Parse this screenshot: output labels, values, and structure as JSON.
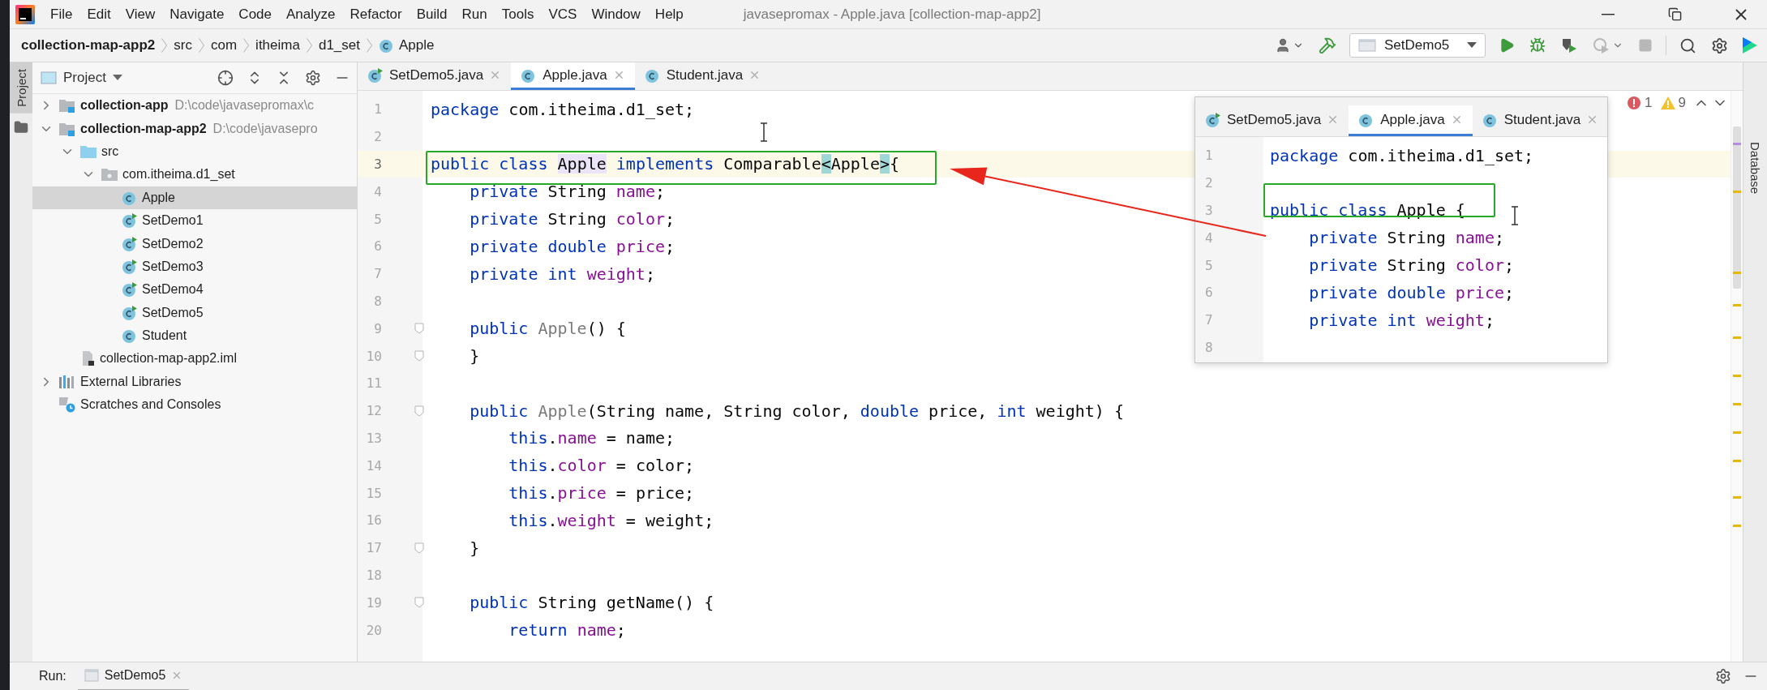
{
  "window": {
    "title": "javasepromax - Apple.java [collection-map-app2]"
  },
  "menu": [
    "File",
    "Edit",
    "View",
    "Navigate",
    "Code",
    "Analyze",
    "Refactor",
    "Build",
    "Run",
    "Tools",
    "VCS",
    "Window",
    "Help"
  ],
  "breadcrumbs": [
    {
      "label": "collection-map-app2",
      "kind": "project"
    },
    {
      "label": "src",
      "kind": "folder"
    },
    {
      "label": "com",
      "kind": "folder"
    },
    {
      "label": "itheima",
      "kind": "folder"
    },
    {
      "label": "d1_set",
      "kind": "folder"
    },
    {
      "label": "Apple",
      "kind": "class"
    }
  ],
  "toolbar": {
    "run_configuration": "SetDemo5",
    "actions": [
      {
        "kind": "run",
        "disabled": false
      },
      {
        "kind": "debug",
        "disabled": false
      },
      {
        "kind": "coverage",
        "disabled": false
      },
      {
        "kind": "profile",
        "disabled": true
      },
      {
        "kind": "stop",
        "disabled": true
      }
    ]
  },
  "tool_windows": {
    "left": [
      {
        "label": "Project",
        "selected": true
      }
    ],
    "right": [
      {
        "label": "Database",
        "selected": false
      }
    ]
  },
  "project_panel": {
    "title": "Project",
    "tree": [
      {
        "label": "collection-app",
        "path": "D:\\code\\javasepromax\\c",
        "kind": "module",
        "expanded": false,
        "selected": false
      },
      {
        "label": "collection-map-app2",
        "path": "D:\\code\\javasepro",
        "kind": "module",
        "expanded": true,
        "selected": false,
        "children": [
          {
            "label": "src",
            "kind": "source-folder",
            "expanded": true,
            "selected": false,
            "children": [
              {
                "label": "com.itheima.d1_set",
                "kind": "package",
                "expanded": true,
                "selected": false,
                "children": [
                  {
                    "label": "Apple",
                    "kind": "class",
                    "selected": true
                  },
                  {
                    "label": "SetDemo1",
                    "kind": "runnable",
                    "selected": false
                  },
                  {
                    "label": "SetDemo2",
                    "kind": "runnable",
                    "selected": false
                  },
                  {
                    "label": "SetDemo3",
                    "kind": "runnable",
                    "selected": false
                  },
                  {
                    "label": "SetDemo4",
                    "kind": "runnable",
                    "selected": false
                  },
                  {
                    "label": "SetDemo5",
                    "kind": "runnable",
                    "selected": false
                  },
                  {
                    "label": "Student",
                    "kind": "class",
                    "selected": false
                  }
                ]
              }
            ]
          },
          {
            "label": "collection-map-app2.iml",
            "kind": "file",
            "selected": false
          }
        ]
      },
      {
        "label": "External Libraries",
        "kind": "libraries",
        "expanded": false,
        "selected": false
      },
      {
        "label": "Scratches and Consoles",
        "kind": "scratches",
        "selected": false
      }
    ]
  },
  "editor": {
    "tabs": [
      {
        "label": "SetDemo5.java",
        "kind": "runnable",
        "selected": false
      },
      {
        "label": "Apple.java",
        "kind": "class",
        "selected": true
      },
      {
        "label": "Student.java",
        "kind": "class",
        "selected": false
      }
    ],
    "problems": {
      "errors": "1",
      "warnings": "9"
    },
    "lines": [
      {
        "number": "1",
        "current": false,
        "fold": false,
        "tokens": [
          {
            "kind": "keyword",
            "text": "package"
          },
          {
            "kind": "plain",
            "text": " com.itheima.d1_set;"
          }
        ]
      },
      {
        "number": "2",
        "current": false,
        "fold": false
      },
      {
        "number": "3",
        "current": true,
        "fold": false,
        "tokens": [
          {
            "kind": "keyword",
            "text": "public class "
          },
          {
            "kind": "usage",
            "text": "Apple"
          },
          {
            "kind": "keyword",
            "text": " implements"
          },
          {
            "kind": "plain",
            "text": " Comparable"
          },
          {
            "kind": "brace",
            "text": "<"
          },
          {
            "kind": "plain",
            "text": "Apple"
          },
          {
            "kind": "brace",
            "text": ">"
          },
          {
            "kind": "plain",
            "text": "{"
          }
        ]
      },
      {
        "number": "4",
        "current": false,
        "fold": false,
        "tokens": [
          {
            "kind": "keyword",
            "text": "    private"
          },
          {
            "kind": "plain",
            "text": " String "
          },
          {
            "kind": "field",
            "text": "name"
          },
          {
            "kind": "plain",
            "text": ";"
          }
        ]
      },
      {
        "number": "5",
        "current": false,
        "fold": false,
        "tokens": [
          {
            "kind": "keyword",
            "text": "    private"
          },
          {
            "kind": "plain",
            "text": " String "
          },
          {
            "kind": "field",
            "text": "color"
          },
          {
            "kind": "plain",
            "text": ";"
          }
        ]
      },
      {
        "number": "6",
        "current": false,
        "fold": false,
        "tokens": [
          {
            "kind": "keyword",
            "text": "    private double "
          },
          {
            "kind": "field",
            "text": "price"
          },
          {
            "kind": "plain",
            "text": ";"
          }
        ]
      },
      {
        "number": "7",
        "current": false,
        "fold": false,
        "tokens": [
          {
            "kind": "keyword",
            "text": "    private int "
          },
          {
            "kind": "field",
            "text": "weight"
          },
          {
            "kind": "plain",
            "text": ";"
          }
        ]
      },
      {
        "number": "8",
        "current": false,
        "fold": false
      },
      {
        "number": "9",
        "current": false,
        "fold": true,
        "tokens": [
          {
            "kind": "keyword",
            "text": "    public "
          },
          {
            "kind": "unused",
            "text": "Apple"
          },
          {
            "kind": "plain",
            "text": "() {"
          }
        ]
      },
      {
        "number": "10",
        "current": false,
        "fold": true,
        "tokens": [
          {
            "kind": "plain",
            "text": "    }"
          }
        ]
      },
      {
        "number": "11",
        "current": false,
        "fold": false
      },
      {
        "number": "12",
        "current": false,
        "fold": true,
        "tokens": [
          {
            "kind": "keyword",
            "text": "    public "
          },
          {
            "kind": "unused",
            "text": "Apple"
          },
          {
            "kind": "plain",
            "text": "(String name, String color, "
          },
          {
            "kind": "keyword",
            "text": "double"
          },
          {
            "kind": "plain",
            "text": " price, "
          },
          {
            "kind": "keyword",
            "text": "int"
          },
          {
            "kind": "plain",
            "text": " weight) {"
          }
        ]
      },
      {
        "number": "13",
        "current": false,
        "fold": false,
        "tokens": [
          {
            "kind": "keyword",
            "text": "        this"
          },
          {
            "kind": "plain",
            "text": "."
          },
          {
            "kind": "field",
            "text": "name"
          },
          {
            "kind": "plain",
            "text": " = name;"
          }
        ]
      },
      {
        "number": "14",
        "current": false,
        "fold": false,
        "tokens": [
          {
            "kind": "keyword",
            "text": "        this"
          },
          {
            "kind": "plain",
            "text": "."
          },
          {
            "kind": "field",
            "text": "color"
          },
          {
            "kind": "plain",
            "text": " = color;"
          }
        ]
      },
      {
        "number": "15",
        "current": false,
        "fold": false,
        "tokens": [
          {
            "kind": "keyword",
            "text": "        this"
          },
          {
            "kind": "plain",
            "text": "."
          },
          {
            "kind": "field",
            "text": "price"
          },
          {
            "kind": "plain",
            "text": " = price;"
          }
        ]
      },
      {
        "number": "16",
        "current": false,
        "fold": false,
        "tokens": [
          {
            "kind": "keyword",
            "text": "        this"
          },
          {
            "kind": "plain",
            "text": "."
          },
          {
            "kind": "field",
            "text": "weight"
          },
          {
            "kind": "plain",
            "text": " = weight;"
          }
        ]
      },
      {
        "number": "17",
        "current": false,
        "fold": true,
        "tokens": [
          {
            "kind": "plain",
            "text": "    }"
          }
        ]
      },
      {
        "number": "18",
        "current": false,
        "fold": false
      },
      {
        "number": "19",
        "current": false,
        "fold": true,
        "tokens": [
          {
            "kind": "keyword",
            "text": "    public"
          },
          {
            "kind": "plain",
            "text": " String getName() {"
          }
        ]
      },
      {
        "number": "20",
        "current": false,
        "fold": false,
        "tokens": [
          {
            "kind": "keyword",
            "text": "        return "
          },
          {
            "kind": "field",
            "text": "name"
          },
          {
            "kind": "plain",
            "text": ";"
          }
        ]
      }
    ]
  },
  "popup": {
    "tabs": [
      {
        "label": "SetDemo5.java",
        "kind": "runnable",
        "selected": false
      },
      {
        "label": "Apple.java",
        "kind": "class",
        "selected": true
      },
      {
        "label": "Student.java",
        "kind": "class",
        "selected": false
      }
    ],
    "lines": [
      {
        "number": "1",
        "tokens": [
          {
            "kind": "keyword",
            "text": "package"
          },
          {
            "kind": "plain",
            "text": " com.itheima.d1_set;"
          }
        ]
      },
      {
        "number": "2"
      },
      {
        "number": "3",
        "tokens": [
          {
            "kind": "keyword",
            "text": "public class"
          },
          {
            "kind": "plain",
            "text": " Apple {"
          }
        ]
      },
      {
        "number": "4",
        "tokens": [
          {
            "kind": "keyword",
            "text": "    private"
          },
          {
            "kind": "plain",
            "text": " String "
          },
          {
            "kind": "field",
            "text": "name"
          },
          {
            "kind": "plain",
            "text": ";"
          }
        ]
      },
      {
        "number": "5",
        "tokens": [
          {
            "kind": "keyword",
            "text": "    private"
          },
          {
            "kind": "plain",
            "text": " String "
          },
          {
            "kind": "field",
            "text": "color"
          },
          {
            "kind": "plain",
            "text": ";"
          }
        ]
      },
      {
        "number": "6",
        "tokens": [
          {
            "kind": "keyword",
            "text": "    private double "
          },
          {
            "kind": "field",
            "text": "price"
          },
          {
            "kind": "plain",
            "text": ";"
          }
        ]
      },
      {
        "number": "7",
        "tokens": [
          {
            "kind": "keyword",
            "text": "    private int "
          },
          {
            "kind": "field",
            "text": "weight"
          },
          {
            "kind": "plain",
            "text": ";"
          }
        ]
      },
      {
        "number": "8"
      }
    ]
  },
  "run_bar": {
    "label": "Run:",
    "tabs": [
      {
        "label": "SetDemo5",
        "selected": true
      }
    ]
  }
}
